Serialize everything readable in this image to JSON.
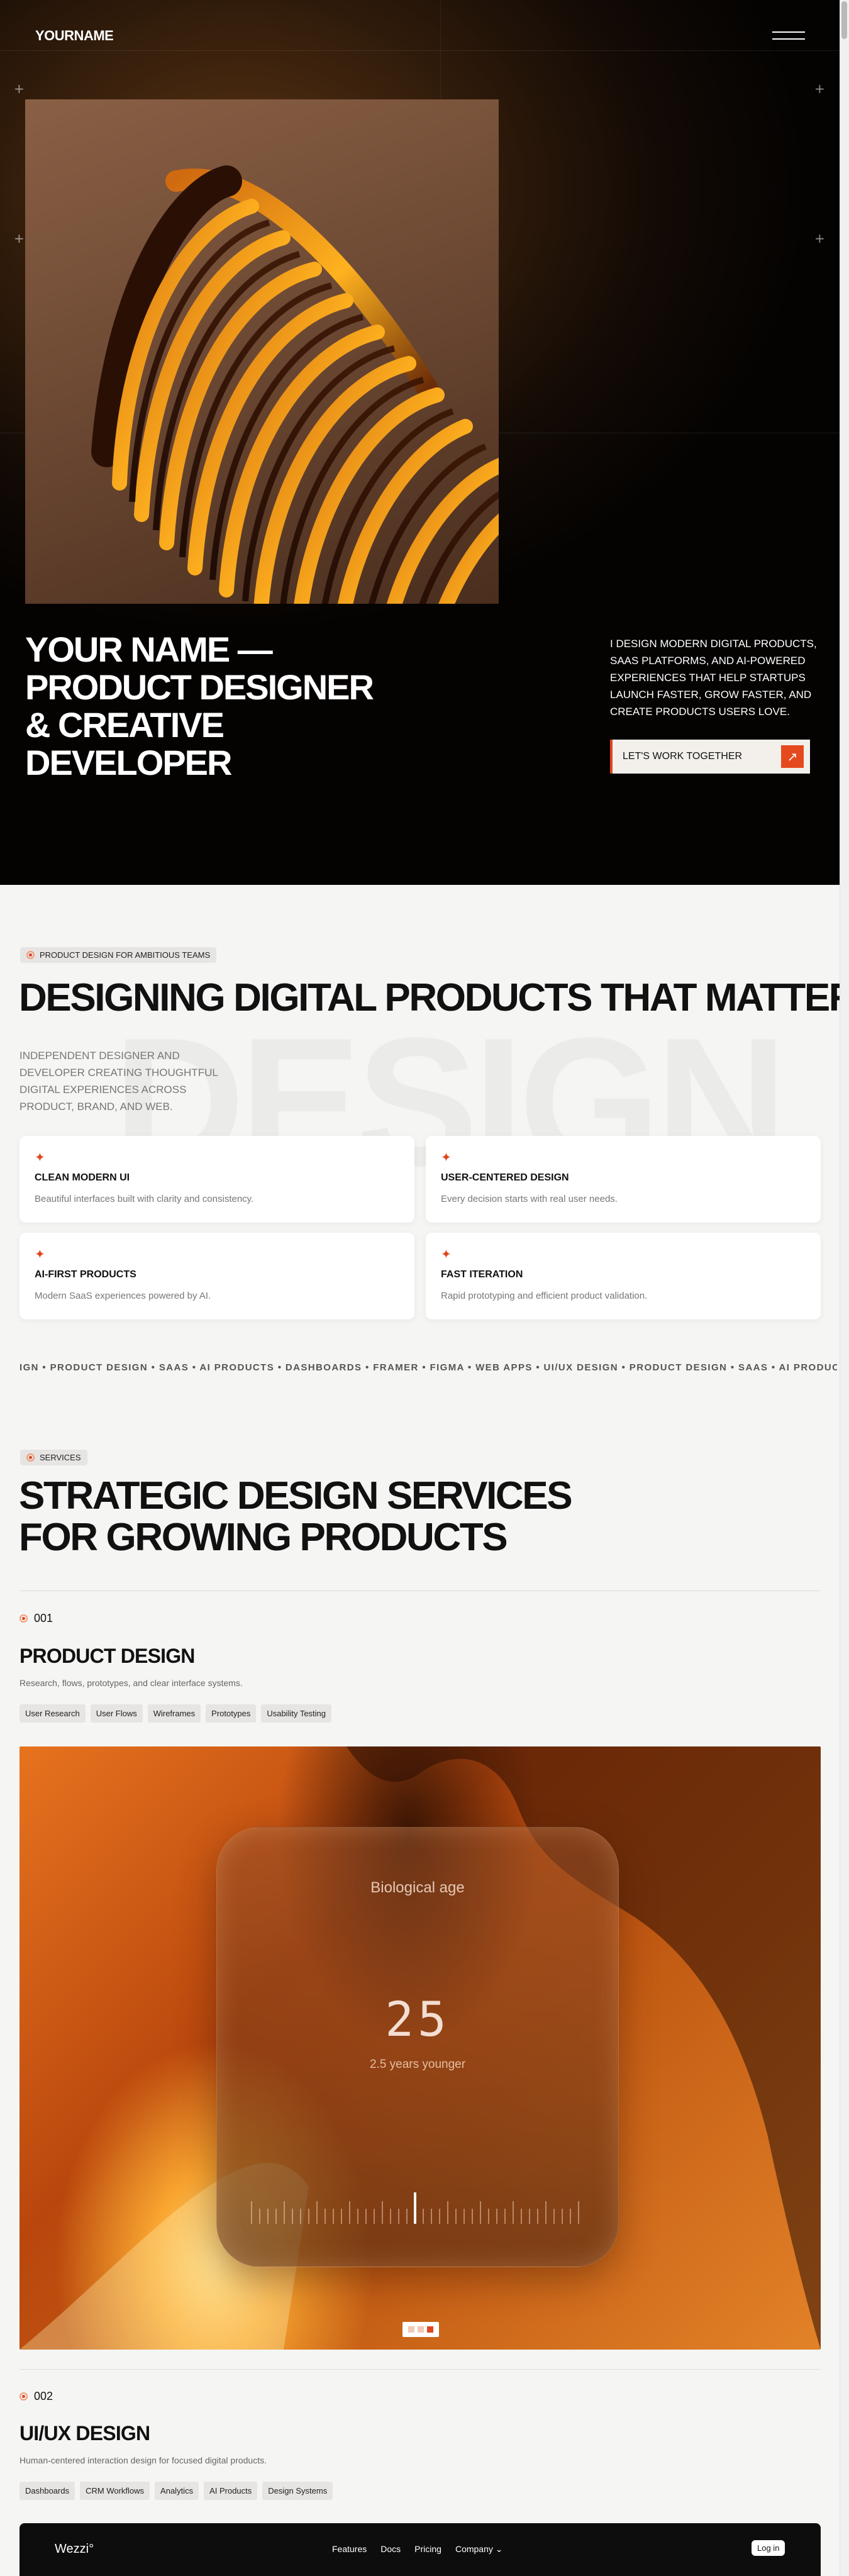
{
  "header": {
    "logo": "YOURNAME",
    "menu_icon": "hamburger-menu-icon"
  },
  "hero": {
    "title": "YOUR NAME — PRODUCT DESIGNER & CREATIVE DEVELOPER",
    "description": "I DESIGN MODERN DIGITAL PRODUCTS, SAAS PLATFORMS, AND AI-POWERED EXPERIENCES THAT HELP STARTUPS LAUNCH FASTER, GROW FASTER, AND CREATE PRODUCTS USERS LOVE.",
    "cta_label": "LET'S WORK TOGETHER",
    "cta_icon": "arrow-up-right-icon",
    "accent": "#e0451c"
  },
  "about": {
    "pill": "PRODUCT DESIGN FOR AMBITIOUS TEAMS",
    "title": "DESIGNING DIGITAL PRODUCTS THAT MATTER",
    "background_word": "DESIGN",
    "subtitle": "INDEPENDENT DESIGNER AND DEVELOPER CREATING THOUGHTFUL DIGITAL EXPERIENCES ACROSS PRODUCT, BRAND, AND WEB.",
    "cards": [
      {
        "title": "CLEAN MODERN UI",
        "desc": "Beautiful interfaces built with clarity and consistency."
      },
      {
        "title": "USER-CENTERED DESIGN",
        "desc": "Every decision starts with real user needs."
      },
      {
        "title": "AI-FIRST PRODUCTS",
        "desc": "Modern SaaS experiences powered by AI."
      },
      {
        "title": "FAST ITERATION",
        "desc": "Rapid prototyping and efficient product validation."
      }
    ]
  },
  "marquee": "IGN • PRODUCT DESIGN • SAAS • AI PRODUCTS • DASHBOARDS • FRAMER • FIGMA • WEB APPS • UI/UX DESIGN • PRODUCT DESIGN • SAAS • AI PRODUCT",
  "services": {
    "pill": "SERVICES",
    "title": "STRATEGIC DESIGN SERVICES FOR GROWING PRODUCTS",
    "items": [
      {
        "num": "001",
        "name": "PRODUCT DESIGN",
        "desc": "Research, flows, prototypes, and clear interface systems.",
        "tags": [
          "User Research",
          "User Flows",
          "Wireframes",
          "Prototypes",
          "Usability Testing"
        ]
      },
      {
        "num": "002",
        "name": "UI/UX DESIGN",
        "desc": "Human-centered interaction design for focused digital products.",
        "tags": [
          "Dashboards",
          "CRM Workflows",
          "Analytics",
          "AI Products",
          "Design Systems"
        ]
      }
    ]
  },
  "showcase": {
    "label": "Biological age",
    "value": "25",
    "caption": "2.5 years younger",
    "active_slide": 3,
    "slide_count": 3
  },
  "preview_nav": {
    "logo": "Wezzi°",
    "links": [
      "Features",
      "Docs",
      "Pricing",
      "Company"
    ],
    "company_icon": "chevron-down-icon",
    "login": "Log in"
  }
}
